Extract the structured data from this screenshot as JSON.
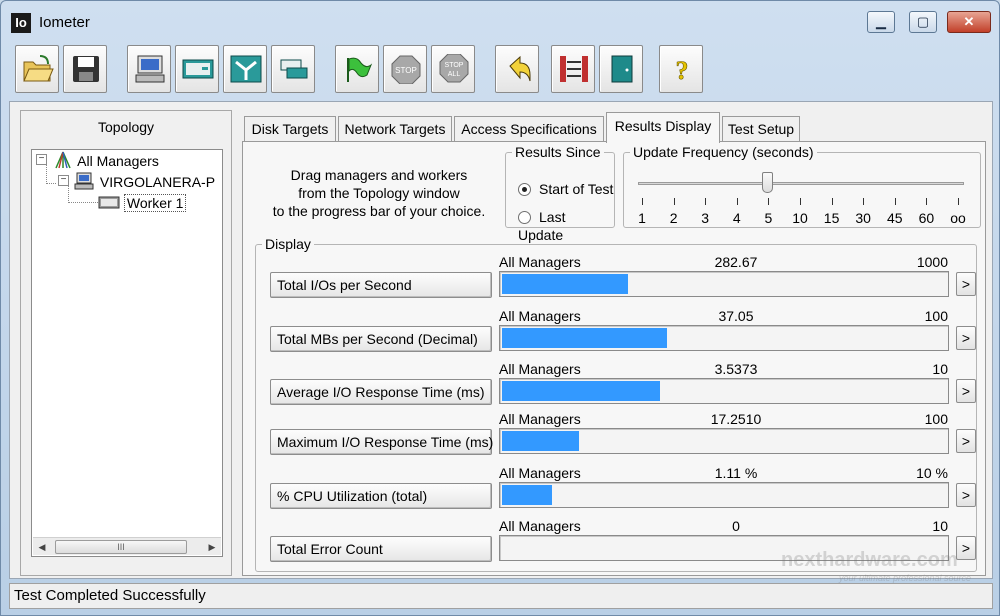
{
  "window": {
    "title": "Iometer",
    "icon_text": "Io",
    "controls": {
      "minimize": "▁",
      "maximize": "▢",
      "close": "✕"
    }
  },
  "toolbar": {
    "buttons": [
      {
        "icon": "open-folder-icon"
      },
      {
        "icon": "save-icon"
      },
      {
        "icon": "start-display-icon"
      },
      {
        "icon": "new-disk-worker-icon"
      },
      {
        "icon": "new-network-worker-icon"
      },
      {
        "icon": "duplicate-worker-icon"
      },
      {
        "icon": "start-flag-icon"
      },
      {
        "icon": "stop-icon",
        "label": "STOP"
      },
      {
        "icon": "stop-all-icon",
        "label": "STOP ALL"
      },
      {
        "icon": "reset-workers-icon"
      },
      {
        "icon": "disconnect-icon"
      },
      {
        "icon": "exit-door-icon"
      },
      {
        "icon": "help-icon",
        "label": "?"
      }
    ]
  },
  "topology": {
    "title": "Topology",
    "tree": [
      {
        "label": "All Managers",
        "icon": "all-managers-icon"
      },
      {
        "label": "VIRGOLANERA-P",
        "icon": "computer-icon"
      },
      {
        "label": "Worker 1",
        "icon": "disk-worker-icon"
      }
    ],
    "scroll_thumb": "III"
  },
  "tabs": [
    {
      "label": "Disk Targets",
      "active": false
    },
    {
      "label": "Network Targets",
      "active": false
    },
    {
      "label": "Access Specifications",
      "active": false
    },
    {
      "label": "Results Display",
      "active": true
    },
    {
      "label": "Test Setup",
      "active": false
    }
  ],
  "results": {
    "hint_line1": "Drag managers and workers",
    "hint_line2": "from the Topology window",
    "hint_line3": "to the progress bar of your choice.",
    "results_since": {
      "title": "Results Since",
      "options": [
        "Start of Test",
        "Last Update"
      ],
      "selected": "Start of Test"
    },
    "update_frequency": {
      "title": "Update Frequency (seconds)",
      "ticks": [
        "1",
        "2",
        "3",
        "4",
        "5",
        "10",
        "15",
        "30",
        "45",
        "60",
        "oo"
      ],
      "selected": "5"
    },
    "display_title": "Display",
    "metrics": [
      {
        "button": "Total I/Os per Second",
        "manager": "All Managers",
        "value": "282.67",
        "max": "1000",
        "fill": 0.2827
      },
      {
        "button": "Total MBs per Second (Decimal)",
        "manager": "All Managers",
        "value": "37.05",
        "max": "100",
        "fill": 0.3705
      },
      {
        "button": "Average I/O Response Time (ms)",
        "manager": "All Managers",
        "value": "3.5373",
        "max": "10",
        "fill": 0.3537
      },
      {
        "button": "Maximum I/O Response Time (ms)",
        "manager": "All Managers",
        "value": "17.2510",
        "max": "100",
        "fill": 0.1725
      },
      {
        "button": "% CPU Utilization (total)",
        "manager": "All Managers",
        "value": "1.11 %",
        "max": "10 %",
        "fill": 0.111
      },
      {
        "button": "Total Error Count",
        "manager": "All Managers",
        "value": "0",
        "max": "10",
        "fill": 0
      }
    ],
    "arrow_label": ">"
  },
  "status": {
    "text": "Test Completed Successfully"
  },
  "watermark": {
    "text": "nexthardware.com",
    "sub": "your ultimate professional source"
  },
  "colors": {
    "bar": "#3399ff",
    "title_bar": "#cfdff0",
    "close_button": "#c2402a"
  }
}
